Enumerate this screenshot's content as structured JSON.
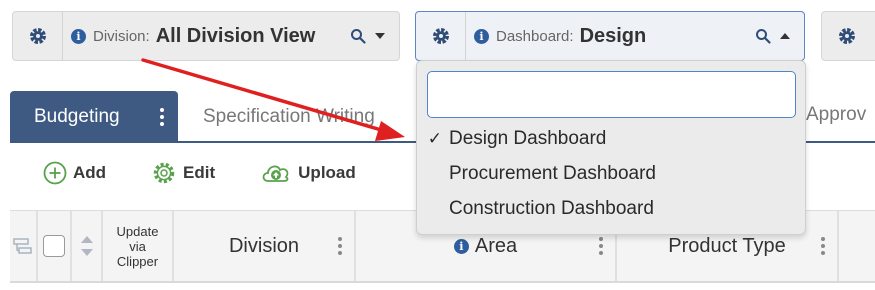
{
  "division_selector": {
    "label": "Division:",
    "value": "All Division View",
    "icons": [
      "gear-icon",
      "info-icon",
      "search-icon",
      "caret-down-icon"
    ]
  },
  "dashboard_selector": {
    "label": "Dashboard:",
    "value": "Design",
    "icons": [
      "gear-icon",
      "info-icon",
      "search-icon",
      "caret-up-icon"
    ]
  },
  "third_selector": {
    "icons": [
      "gear-icon"
    ]
  },
  "tabs": [
    {
      "label": "Budgeting",
      "active": true
    },
    {
      "label": "Specification Writing",
      "active": false
    }
  ],
  "tab_partial_right": "Approv",
  "toolbar": [
    {
      "label": "Add",
      "icon": "plus-circle-icon"
    },
    {
      "label": "Edit",
      "icon": "gear-outline-icon"
    },
    {
      "label": "Upload",
      "icon": "cloud-upload-icon"
    }
  ],
  "grid": {
    "columns": [
      {
        "label": "Update via Clipper"
      },
      {
        "label": "Division"
      },
      {
        "label": "Area",
        "icon": "info-icon"
      },
      {
        "label": "Product Type"
      }
    ]
  },
  "dropdown": {
    "search_value": "",
    "options": [
      {
        "label": "Design Dashboard",
        "selected": true,
        "check": "✓"
      },
      {
        "label": "Procurement Dashboard",
        "selected": false,
        "check": ""
      },
      {
        "label": "Construction Dashboard",
        "selected": false,
        "check": ""
      }
    ]
  },
  "colors": {
    "accent_blue": "#3e5a82",
    "focus_blue": "#4d86c9",
    "arrow_red": "#e02020",
    "green_icon": "#58a24b"
  }
}
